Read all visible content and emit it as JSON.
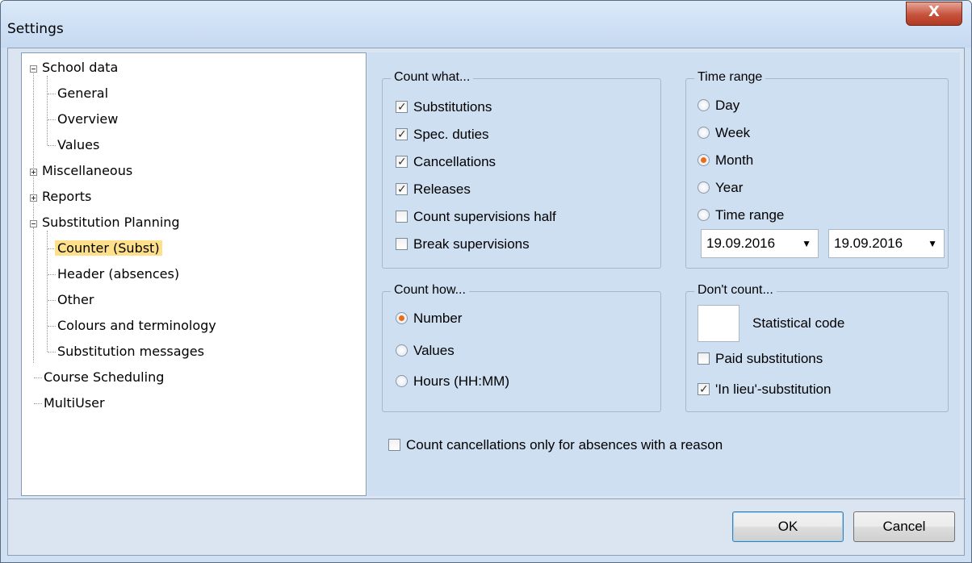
{
  "window": {
    "title": "Settings",
    "close_label": "X"
  },
  "tree": {
    "school_data": "School data",
    "general": "General",
    "overview": "Overview",
    "values": "Values",
    "miscellaneous": "Miscellaneous",
    "reports": "Reports",
    "substitution_planning": "Substitution Planning",
    "counter": "Counter (Subst)",
    "header": "Header (absences)",
    "other": "Other",
    "colours": "Colours and terminology",
    "messages": "Substitution messages",
    "course_scheduling": "Course Scheduling",
    "multiuser": "MultiUser"
  },
  "count_what": {
    "title": "Count what...",
    "items": [
      {
        "label": "Substitutions",
        "checked": true
      },
      {
        "label": "Spec. duties",
        "checked": true
      },
      {
        "label": "Cancellations",
        "checked": true
      },
      {
        "label": "Releases",
        "checked": true
      },
      {
        "label": "Count supervisions half",
        "checked": false
      },
      {
        "label": "Break supervisions",
        "checked": false
      }
    ]
  },
  "time_range": {
    "title": "Time range",
    "options": [
      "Day",
      "Week",
      "Month",
      "Year",
      "Time range"
    ],
    "selected": "Month",
    "from": "19.09.2016",
    "to": "19.09.2016"
  },
  "count_how": {
    "title": "Count how...",
    "options": [
      "Number",
      "Values",
      "Hours (HH:MM)"
    ],
    "selected": "Number"
  },
  "dont_count": {
    "title": "Don't count...",
    "stat_code_label": "Statistical code",
    "stat_code_value": "",
    "paid_label": "Paid substitutions",
    "paid_checked": false,
    "in_lieu_label": "'In lieu'-substitution",
    "in_lieu_checked": true
  },
  "only_reason": {
    "label": "Count cancellations only for absences with a reason",
    "checked": false
  },
  "buttons": {
    "ok": "OK",
    "cancel": "Cancel"
  }
}
